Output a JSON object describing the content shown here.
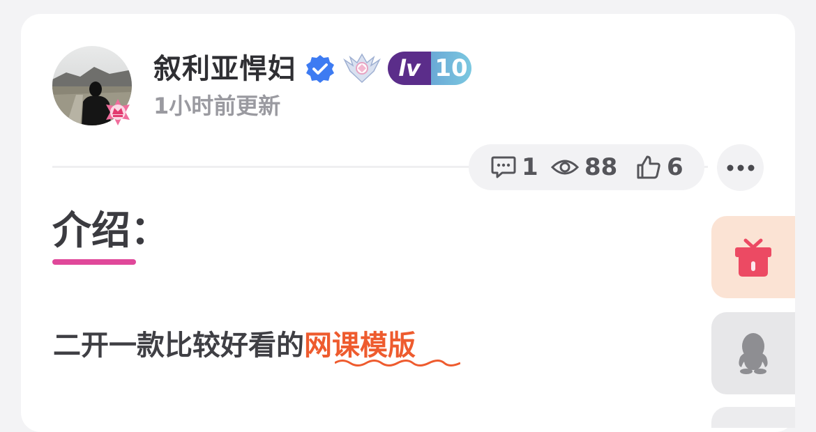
{
  "post": {
    "author": "叙利亚悍妇",
    "level_prefix": "lv",
    "level_number": "10",
    "updated": "1小时前更新"
  },
  "stats": {
    "comments": "1",
    "views": "88",
    "likes": "6"
  },
  "content": {
    "section_title": "介绍：",
    "intro_plain": "二开一款比较好看的",
    "intro_link": "网课模版"
  },
  "icons": {
    "verified": "verified-check-icon",
    "crest": "crystal-crest-icon",
    "comment": "comment-icon",
    "views": "eye-icon",
    "likes": "thumbs-up-icon",
    "more": "more-dots-icon",
    "gift": "gift-icon",
    "qq": "qq-penguin-icon"
  },
  "colors": {
    "accent_pink": "#e0489a",
    "link_orange": "#ee5b2e",
    "verified_blue": "#3d7bf2",
    "gift_red": "#ec4a63"
  }
}
